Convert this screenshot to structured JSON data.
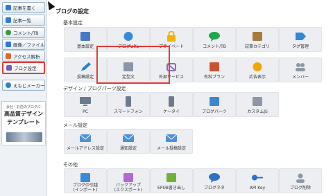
{
  "sidebar": {
    "items": [
      {
        "label": "記事を書く",
        "icon": "pencil-icon",
        "color": "#2e7bd6"
      },
      {
        "label": "記事一覧",
        "icon": "list-icon",
        "color": "#2e7bd6"
      },
      {
        "label": "コメント/TB",
        "icon": "comment-icon",
        "color": "#3a9a3a"
      },
      {
        "label": "画像／ファイル",
        "icon": "image-icon",
        "color": "#2e7bd6"
      },
      {
        "label": "アクセス解析",
        "icon": "chart-icon",
        "color": "#e0672b"
      },
      {
        "label": "ブログ設定",
        "icon": "wrench-icon",
        "color": "#7a5bb6"
      },
      {
        "label": "えもじメーカー",
        "icon": "emoji-icon",
        "color": "#3a7bd0"
      }
    ],
    "ad": {
      "small": "会社・お店のブログに",
      "big1": "高品質デザイン",
      "big2": "テンプレート"
    }
  },
  "page_title": "ブログの設定",
  "sections": [
    {
      "title": "基本設定",
      "tiles": [
        {
          "label": "基本設定",
          "icon": "id-card-icon",
          "color": "#4a78c8"
        },
        {
          "label": "ブログURL",
          "icon": "globe-icon",
          "color": "#3b8ad9"
        },
        {
          "label": "プライベート",
          "icon": "lock-icon",
          "color": "#f0b400"
        },
        {
          "label": "コメント/TB",
          "icon": "speech-bubble-icon",
          "color": "#1aa84a"
        },
        {
          "label": "記事カテゴリ",
          "icon": "folder-icon",
          "color": "#a87a3e"
        },
        {
          "label": "タグ管理",
          "icon": "tag-icon",
          "color": "#2f88d8"
        },
        {
          "label": "投稿設定",
          "icon": "pencil-icon",
          "color": "#2b7fd9"
        },
        {
          "label": "定型文",
          "icon": "template-icon",
          "color": "#8a96a8"
        },
        {
          "label": "外部サービス",
          "icon": "puzzle-icon",
          "color": "#8e6ab8"
        },
        {
          "label": "有料プラン",
          "icon": "briefcase-icon",
          "color": "#c9542e"
        },
        {
          "label": "広告表示",
          "icon": "coin-icon",
          "color": "#f2a600"
        },
        {
          "label": "メンバー",
          "icon": "members-icon",
          "color": "#8d97a5"
        }
      ]
    },
    {
      "title": "デザイン / ブログパーツ設定",
      "tiles": [
        {
          "label": "PC",
          "icon": "monitor-icon",
          "color": "#6c7a8c"
        },
        {
          "label": "スマートフォン",
          "icon": "smartphone-icon",
          "color": "#6c7a8c"
        },
        {
          "label": "ケータイ",
          "icon": "feature-phone-icon",
          "color": "#6c7a8c"
        },
        {
          "label": "ブログパーツ",
          "icon": "parts-icon",
          "color": "#3d86d6"
        },
        {
          "label": "カスタムJS",
          "icon": "js-icon",
          "color": "#8d97a5"
        }
      ]
    },
    {
      "title": "メール設定",
      "tiles": [
        {
          "label": "メールアドレス設定",
          "icon": "mail-icon",
          "color": "#4d8fd8"
        },
        {
          "label": "通知設定",
          "icon": "mail-alert-icon",
          "color": "#4d8fd8"
        },
        {
          "label": "メール投稿設定",
          "icon": "mail-post-icon",
          "color": "#4d8fd8"
        }
      ]
    },
    {
      "title": "その他",
      "tiles": [
        {
          "label": "ブログの引越\n(インポート)",
          "icon": "import-icon",
          "color": "#3b8ad9"
        },
        {
          "label": "バックアップ\n(エクスポート)",
          "icon": "export-icon",
          "color": "#b06ad0"
        },
        {
          "label": "EPUB書き出し",
          "icon": "epub-icon",
          "color": "#6fb23a"
        },
        {
          "label": "ブログネタ",
          "icon": "topics-icon",
          "color": "#2f6fc8"
        },
        {
          "label": "API Key",
          "icon": "key-icon",
          "color": "#2f6fc8"
        },
        {
          "label": "ブログ削除",
          "icon": "delete-icon",
          "color": "#8d97a5"
        }
      ]
    }
  ],
  "highlight_color": "#e53935"
}
